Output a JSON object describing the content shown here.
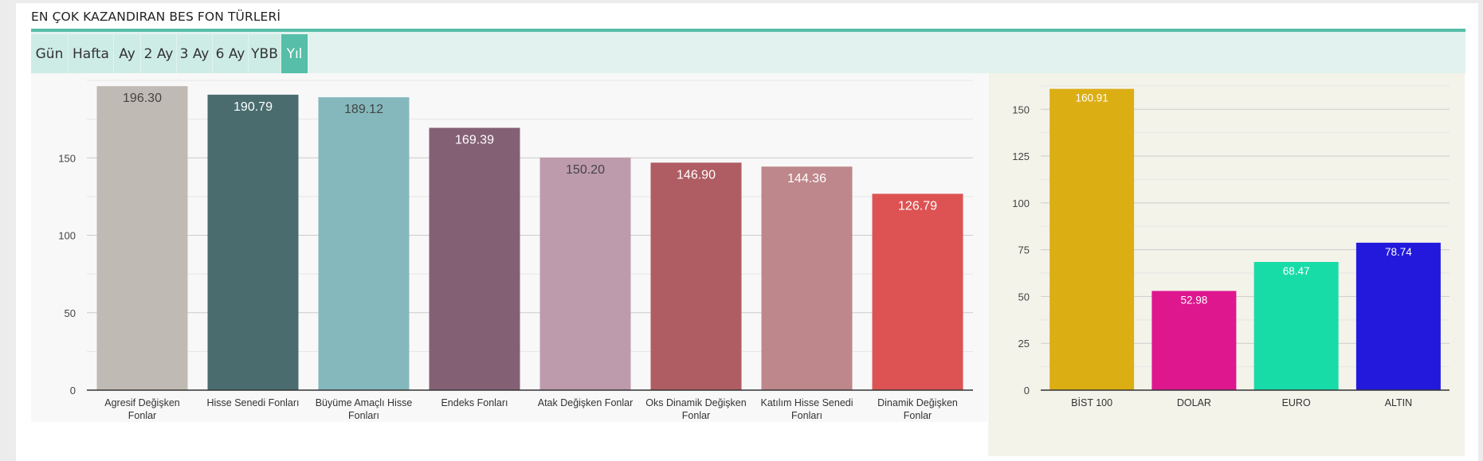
{
  "widget": {
    "title": "EN ÇOK KAZANDIRAN BES FON TÜRLERİ",
    "tabs": [
      {
        "label": "Gün",
        "active": false
      },
      {
        "label": "Hafta",
        "active": false
      },
      {
        "label": "Ay",
        "active": false
      },
      {
        "label": "2 Ay",
        "active": false
      },
      {
        "label": "3 Ay",
        "active": false
      },
      {
        "label": "6 Ay",
        "active": false
      },
      {
        "label": "YBB",
        "active": false
      },
      {
        "label": "Yıl",
        "active": true
      }
    ]
  },
  "chart_data": [
    {
      "type": "bar",
      "title": "",
      "xlabel": "",
      "ylabel": "",
      "ylim": [
        0,
        200
      ],
      "yticks": [
        0,
        50,
        100,
        150
      ],
      "grid": true,
      "categories": [
        "Agresif Değişken Fonlar",
        "Hisse Senedi Fonları",
        "Büyüme Amaçlı Hisse Fonları",
        "Endeks Fonları",
        "Atak Değişken Fonlar",
        "Oks Dinamik Değişken Fonlar",
        "Katılım Hisse Senedi Fonları",
        "Dinamik Değişken Fonlar"
      ],
      "category_lines": [
        [
          "Agresif Değişken",
          "Fonlar"
        ],
        [
          "Hisse Senedi Fonları"
        ],
        [
          "Büyüme Amaçlı Hisse",
          "Fonları"
        ],
        [
          "Endeks Fonları"
        ],
        [
          "Atak Değişken Fonlar"
        ],
        [
          "Oks Dinamik Değişken",
          "Fonlar"
        ],
        [
          "Katılım Hisse Senedi",
          "Fonları"
        ],
        [
          "Dinamik Değişken",
          "Fonlar"
        ]
      ],
      "values": [
        196.3,
        190.79,
        189.12,
        169.39,
        150.2,
        146.9,
        144.36,
        126.79
      ],
      "value_labels": [
        "196.30",
        "190.79",
        "189.12",
        "169.39",
        "150.20",
        "146.90",
        "144.36",
        "126.79"
      ],
      "colors": [
        "#c0bab4",
        "#4a6c6f",
        "#84b8bc",
        "#846075",
        "#bd9bad",
        "#af5d63",
        "#be878b",
        "#dd5353"
      ],
      "label_colors": [
        "#444444",
        "#ffffff",
        "#444444",
        "#ffffff",
        "#444444",
        "#ffffff",
        "#ffffff",
        "#ffffff"
      ]
    },
    {
      "type": "bar",
      "title": "",
      "xlabel": "",
      "ylabel": "",
      "ylim": [
        0,
        165
      ],
      "yticks": [
        0,
        25,
        50,
        75,
        100,
        125,
        150
      ],
      "grid": true,
      "categories": [
        "BİST 100",
        "DOLAR",
        "EURO",
        "ALTIN"
      ],
      "values": [
        160.91,
        52.98,
        68.47,
        78.74
      ],
      "value_labels": [
        "160.91",
        "52.98",
        "68.47",
        "78.74"
      ],
      "colors": [
        "#dbae14",
        "#de178f",
        "#18dca7",
        "#2219dc"
      ],
      "label_colors": [
        "#ffffff",
        "#ffffff",
        "#ffffff",
        "#ffffff"
      ]
    }
  ]
}
